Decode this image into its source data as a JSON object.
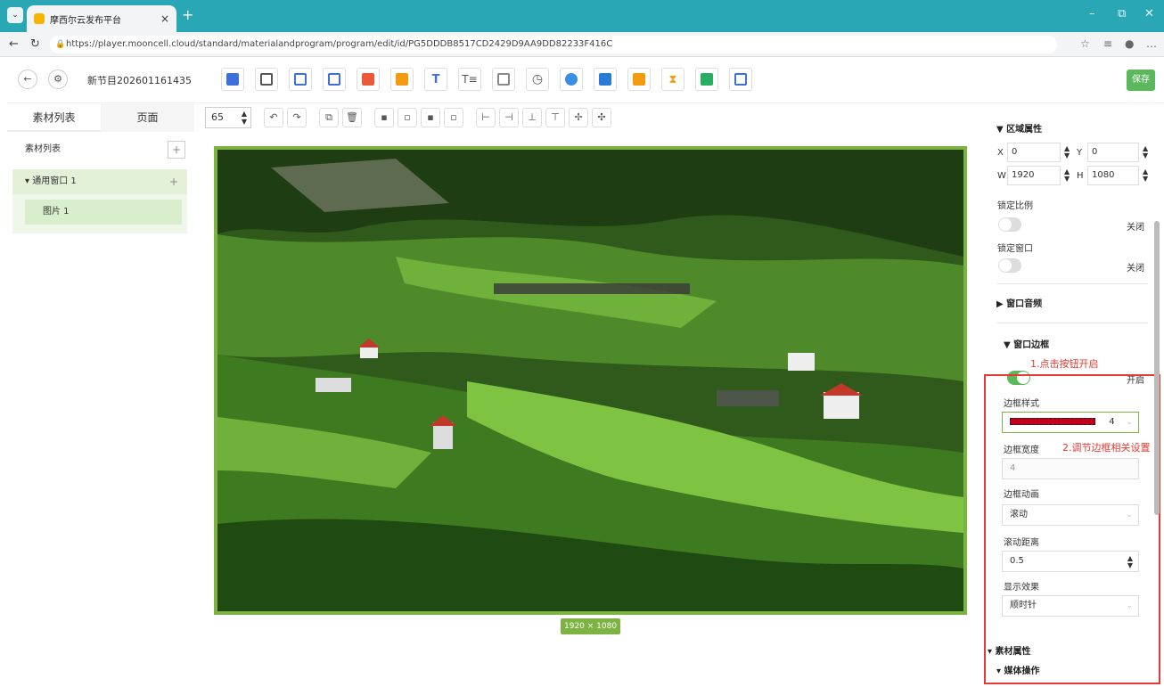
{
  "browser": {
    "tab_title": "摩西尔云发布平台",
    "url": "https://player.mooncell.cloud/standard/materialandprogram/program/edit/id/PG5DDDB8517CD2429D9AA9DD82233F416C"
  },
  "header": {
    "program_name": "新节目202601161435",
    "save_label": "保存",
    "tool_icons": [
      "program-icon",
      "copy-icon",
      "list-icon",
      "video-icon",
      "image-icon",
      "folder-icon",
      "text-icon",
      "rich-text-icon",
      "web-icon",
      "clock-icon",
      "weather-icon",
      "calculator-icon",
      "bar-icon",
      "hourglass-icon",
      "file-icon",
      "link-icon"
    ]
  },
  "left": {
    "tab_material": "素材列表",
    "tab_page": "页面",
    "list_header": "素材列表",
    "plus": "+",
    "group_title": "▾ 通用窗口 1",
    "group_item": "图片 1"
  },
  "canvas": {
    "zoom": "65",
    "size_badge": "1920 × 1080"
  },
  "right": {
    "area_title": "区域属性",
    "x_label": "X",
    "x_value": "0",
    "y_label": "Y",
    "y_value": "0",
    "w_label": "W",
    "w_value": "1920",
    "h_label": "H",
    "h_value": "1080",
    "lock_ratio_label": "锁定比例",
    "lock_ratio_state": "关闭",
    "lock_window_label": "锁定窗口",
    "lock_window_state": "关闭",
    "window_audio": "窗口音频",
    "window_border": "窗口边框",
    "annot1": "1.点击按钮开启",
    "border_state": "开启",
    "border_style_label": "边框样式",
    "border_style_value": "4",
    "border_width_label": "边框宽度",
    "annot2": "2.调节边框相关设置",
    "border_width_value": "4",
    "border_anim_label": "边框动画",
    "border_anim_value": "滚动",
    "scroll_dist_label": "滚动距离",
    "scroll_dist_value": "0.5",
    "display_effect_label": "显示效果",
    "display_effect_value": "顺时针",
    "material_attrs": "▾ 素材属性",
    "media_ops": "▾ 媒体操作"
  }
}
